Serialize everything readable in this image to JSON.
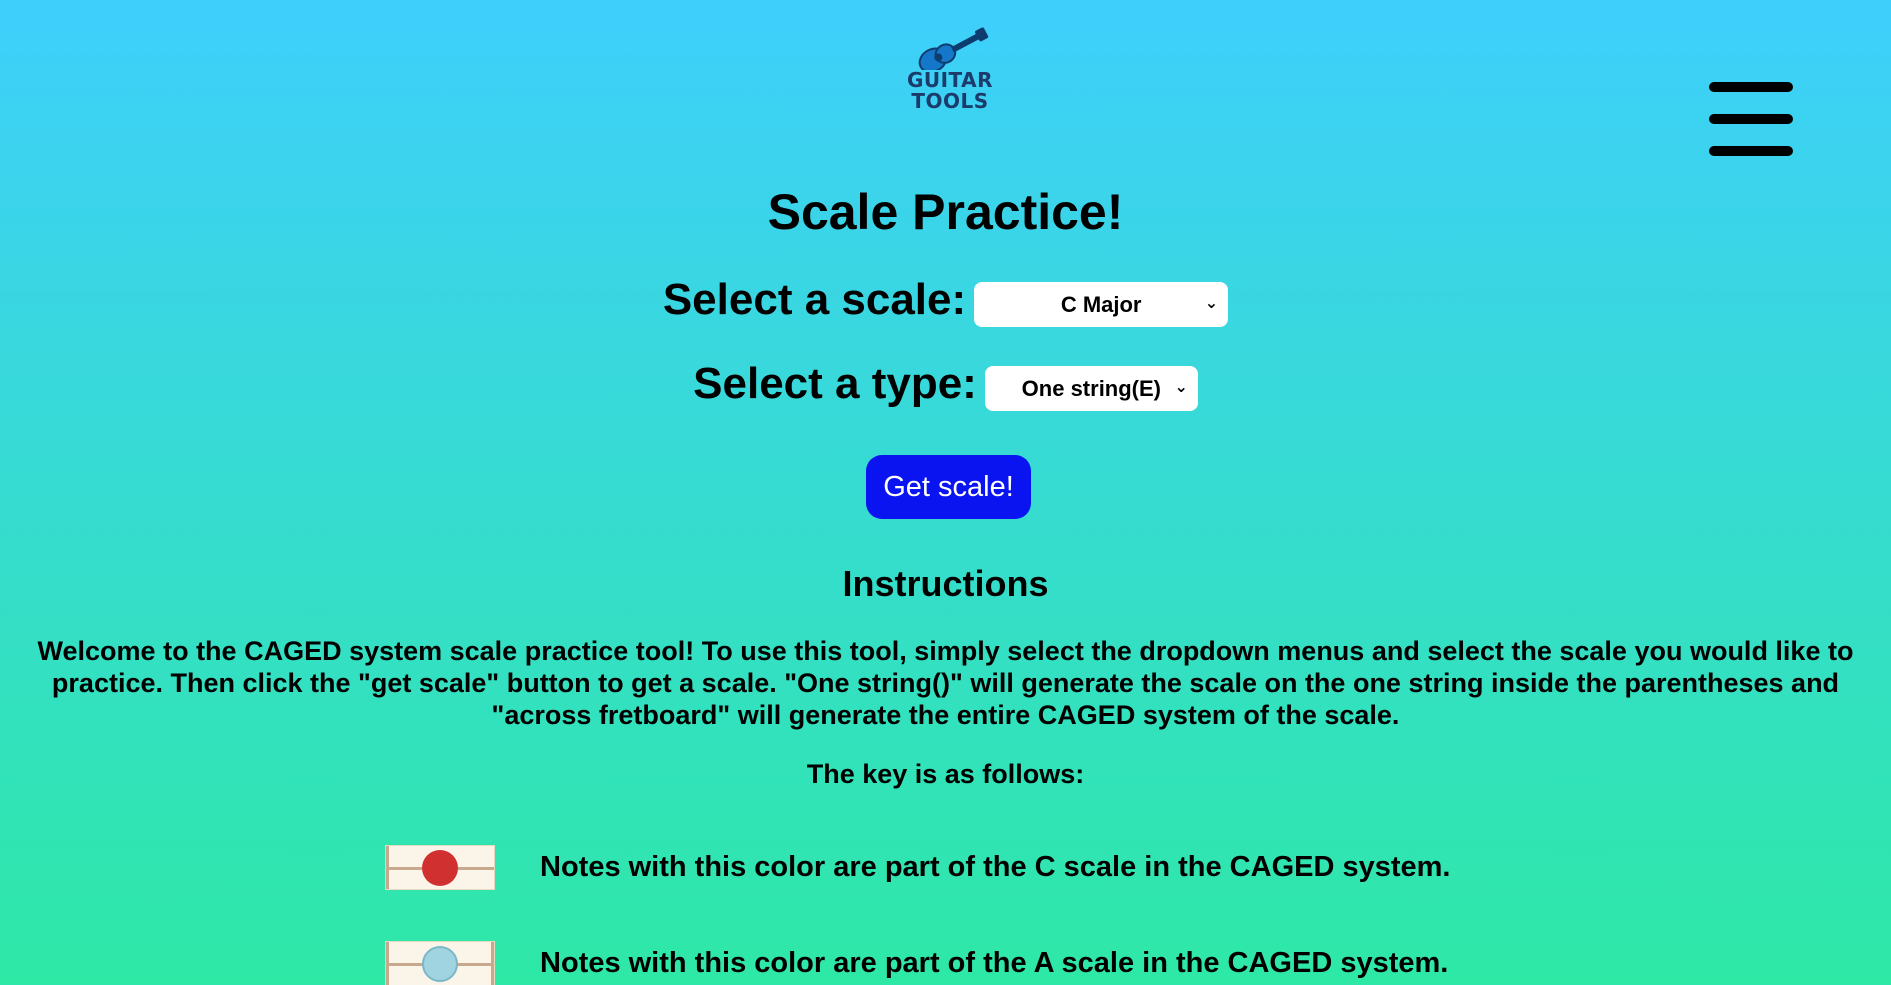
{
  "header": {
    "logo_line1": "GUITAR",
    "logo_line2": "TOOLS",
    "logo_icon": "guitar-icon",
    "menu_icon": "hamburger-menu-icon"
  },
  "page": {
    "title": "Scale Practice!"
  },
  "scale_select": {
    "label": "Select a scale:",
    "value": "C Major"
  },
  "type_select": {
    "label": "Select a type:",
    "value": "One string(E)"
  },
  "get_button": {
    "label": "Get scale!",
    "color": "#0a14f0"
  },
  "instructions": {
    "title": "Instructions",
    "text": "Welcome to the CAGED system scale practice tool! To use this tool, simply select the dropdown menus and select the scale you would like to practice. Then click the \"get scale\" button to get a scale. \"One string()\" will generate the scale on the one string inside the parentheses and \"across fretboard\" will generate the entire CAGED system of the scale.",
    "key_heading": "The key is as follows:"
  },
  "key": [
    {
      "text": "Notes with this color are part of the C scale in the CAGED system.",
      "color": "#d03030"
    },
    {
      "text": "Notes with this color are part of the A scale in the CAGED system.",
      "color": "#9fd4e0"
    }
  ],
  "colors": {
    "background_top": "#3ecffc",
    "background_bottom": "#2ee8a6"
  }
}
